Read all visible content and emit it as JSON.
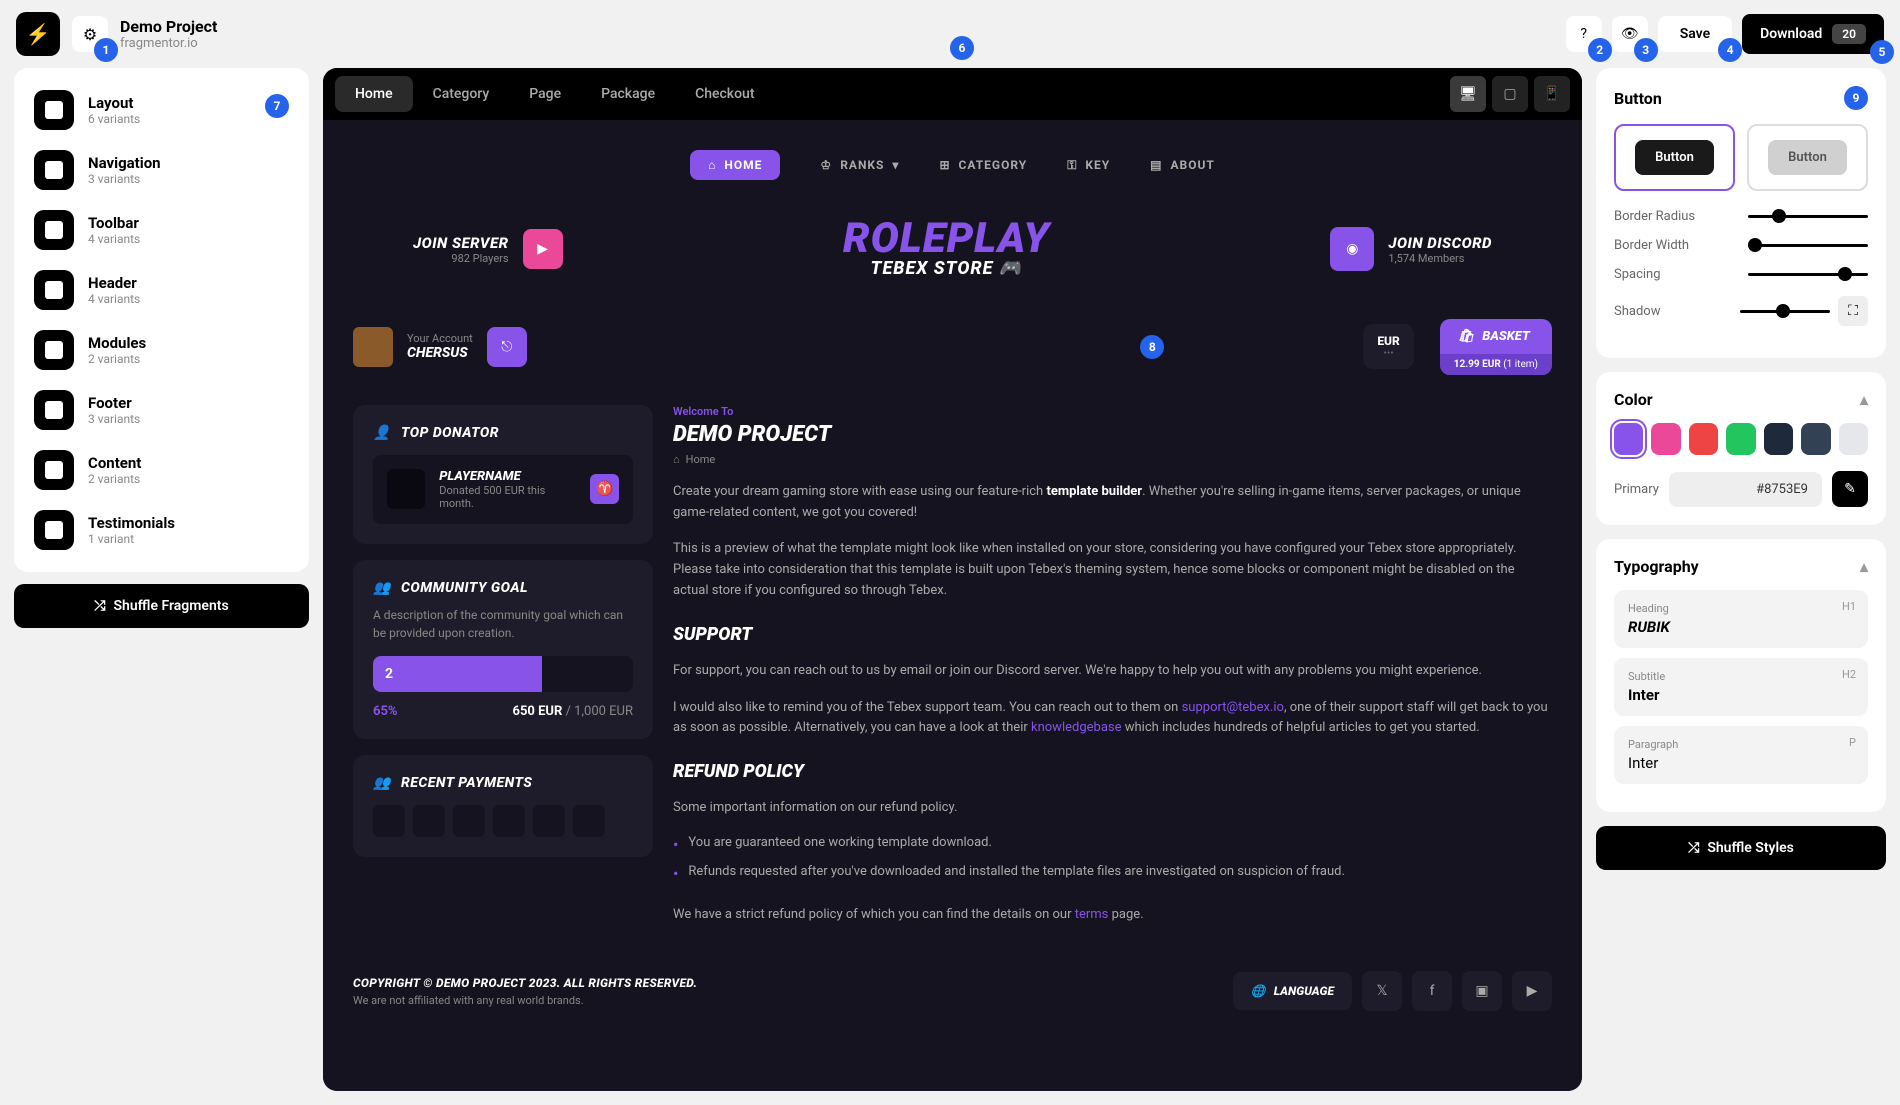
{
  "header": {
    "project_title": "Demo Project",
    "project_sub": "fragmentor.io",
    "save_label": "Save",
    "download_label": "Download",
    "download_count": "20"
  },
  "fragments": [
    {
      "name": "Layout",
      "sub": "6 variants"
    },
    {
      "name": "Navigation",
      "sub": "3 variants"
    },
    {
      "name": "Toolbar",
      "sub": "4 variants"
    },
    {
      "name": "Header",
      "sub": "4 variants"
    },
    {
      "name": "Modules",
      "sub": "2 variants"
    },
    {
      "name": "Footer",
      "sub": "3 variants"
    },
    {
      "name": "Content",
      "sub": "2 variants"
    },
    {
      "name": "Testimonials",
      "sub": "1 variant"
    }
  ],
  "shuffle_fragments": "Shuffle Fragments",
  "preview_tabs": [
    "Home",
    "Category",
    "Page",
    "Package",
    "Checkout"
  ],
  "store": {
    "nav": [
      "HOME",
      "RANKS",
      "CATEGORY",
      "KEY",
      "ABOUT"
    ],
    "join_server": "JOIN SERVER",
    "join_server_sub": "982 Players",
    "logo_top": "ROLEPLAY",
    "logo_bottom": "TEBEX STORE",
    "join_discord": "JOIN DISCORD",
    "join_discord_sub": "1,574 Members",
    "account_label": "Your Account",
    "account_name": "CHERSUS",
    "currency": "EUR",
    "basket_label": "BASKET",
    "basket_price": "12.99 EUR",
    "basket_items": "(1 item)",
    "top_donator_title": "TOP DONATOR",
    "donator_name": "PLAYERNAME",
    "donator_sub": "Donated 500 EUR this month.",
    "goal_title": "COMMUNITY GOAL",
    "goal_desc": "A description of the community goal which can be provided upon creation.",
    "goal_progress": "2",
    "goal_pct": "65%",
    "goal_current": "650 EUR",
    "goal_target": "/ 1,000 EUR",
    "recent_title": "RECENT PAYMENTS",
    "welcome": "Welcome To",
    "demo_title": "DEMO PROJECT",
    "breadcrumb": "Home",
    "para1a": "Create your dream gaming store with ease using our feature-rich ",
    "para1b": "template builder",
    "para1c": ". Whether you're selling in-game items, server packages, or unique game-related content, we got you covered!",
    "para2": "This is a preview of what the template might look like when installed on your store, considering you have configured your Tebex store appropriately. Please take into consideration that this template is built upon Tebex's theming system, hence some blocks or component might be disabled on the actual store if you configured so through Tebex.",
    "support_title": "SUPPORT",
    "support_p1": "For support, you can reach out to us by email or join our Discord server. We're happy to help you out with any problems you might experience.",
    "support_p2a": "I would also like to remind you of the Tebex support team. You can reach out to them on ",
    "support_email": "support@tebex.io",
    "support_p2b": ", one of their support staff will get back to you as soon as possible. Alternatively, you can have a look at their ",
    "support_kb": "knowledgebase",
    "support_p2c": " which includes hundreds of helpful articles to get you started.",
    "refund_title": "REFUND POLICY",
    "refund_p1": "Some important information on our refund policy.",
    "refund_b1": "You are guaranteed one working template download.",
    "refund_b2": "Refunds requested after you've downloaded and installed the template files are investigated on suspicion of fraud.",
    "refund_p2a": "We have a strict refund policy of which you can find the details on our ",
    "refund_terms": "terms",
    "refund_p2b": " page.",
    "copyright": "COPYRIGHT © DEMO PROJECT 2023. ALL RIGHTS RESERVED.",
    "copyright_sub": "We are not affiliated with any real world brands.",
    "language": "LANGUAGE"
  },
  "right": {
    "button_title": "Button",
    "btn_label": "Button",
    "border_radius": "Border Radius",
    "border_width": "Border Width",
    "spacing": "Spacing",
    "shadow": "Shadow",
    "color_title": "Color",
    "primary_label": "Primary",
    "primary_value": "#8753E9",
    "typo_title": "Typography",
    "heading_label": "Heading",
    "heading_value": "RUBIK",
    "subtitle_label": "Subtitle",
    "subtitle_value": "Inter",
    "para_label": "Paragraph",
    "para_value": "Inter",
    "shuffle_styles": "Shuffle Styles"
  },
  "colors": [
    "#8753E9",
    "#ec4899",
    "#ef4444",
    "#22c55e",
    "#1e293b",
    "#334155",
    "#e5e7eb"
  ],
  "badges": [
    "1",
    "2",
    "3",
    "4",
    "5",
    "6",
    "7",
    "8",
    "9"
  ]
}
